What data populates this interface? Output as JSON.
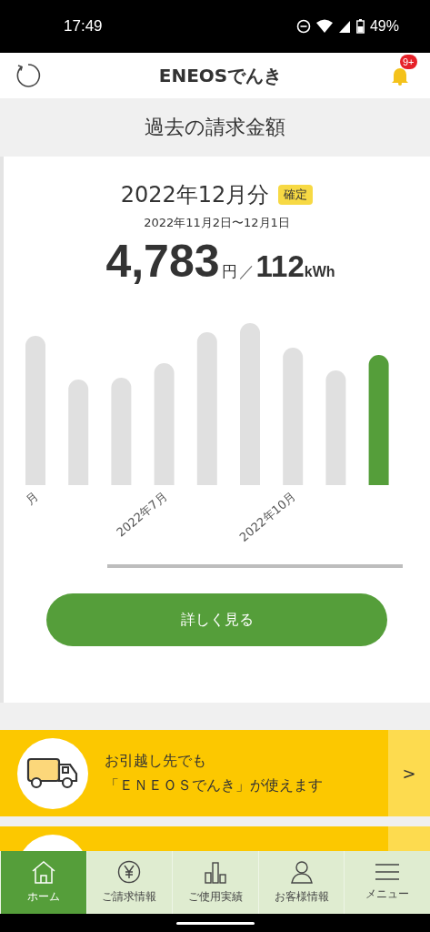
{
  "status_bar": {
    "time": "17:49",
    "battery": "49%"
  },
  "header": {
    "logo": "ENEOSでんき",
    "notification_badge": "9+"
  },
  "section_title": "過去の請求金額",
  "bill": {
    "period": "2022年12月分",
    "status_badge": "確定",
    "date_range": "2022年11月2日〜12月1日",
    "amount": "4,783",
    "amount_unit": "円",
    "separator": "／",
    "usage": "112",
    "usage_unit": "kWh"
  },
  "usage_chart": {
    "bars": [
      {
        "selected": false,
        "label": "月"
      },
      {
        "selected": false
      },
      {
        "selected": false
      },
      {
        "selected": false,
        "label": "2022年7月"
      },
      {
        "selected": false
      },
      {
        "selected": false
      },
      {
        "selected": false,
        "label": "2022年10月"
      },
      {
        "selected": false
      },
      {
        "selected": true
      }
    ]
  },
  "details_button": "詳しく見る",
  "banners": [
    {
      "kind": "moving",
      "line1": "お引越し先でも",
      "line2": "「ＥＮＥＯＳでんき」が使えます",
      "arrow": ">"
    },
    {
      "kind": "partial"
    }
  ],
  "nav": [
    {
      "kind": "home",
      "label": "ホーム",
      "selected": true
    },
    {
      "kind": "bill",
      "label": "ご請求情報",
      "selected": false
    },
    {
      "kind": "usage",
      "label": "ご使用実績",
      "selected": false
    },
    {
      "kind": "account",
      "label": "お客様情報",
      "selected": false
    },
    {
      "kind": "menu",
      "label": "メニュー",
      "selected": false
    }
  ]
}
